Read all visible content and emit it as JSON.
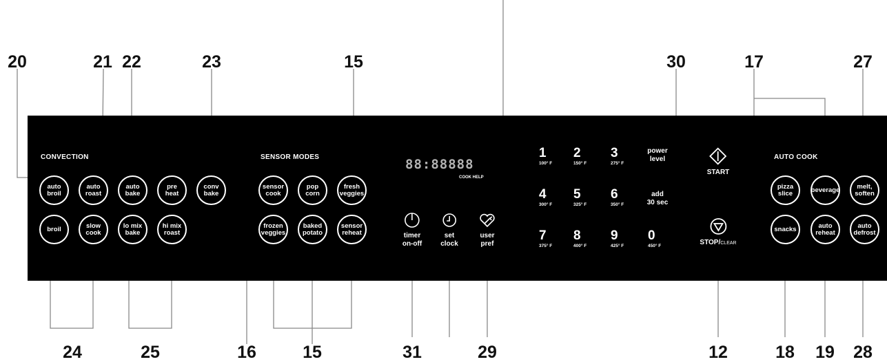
{
  "colors": {
    "panel": "#000000",
    "text_on_panel": "#ffffff",
    "callout": "#111111",
    "leader": "#888888"
  },
  "callouts_top": [
    "20",
    "21",
    "22",
    "23",
    "15",
    "30",
    "17",
    "27"
  ],
  "callouts_bottom": [
    "24",
    "25",
    "16",
    "15",
    "31",
    "29",
    "12",
    "18",
    "19",
    "28"
  ],
  "sections": {
    "convection": "CONVECTION",
    "sensor": "SENSOR MODES",
    "autocook": "AUTO COOK"
  },
  "display": {
    "digits": "88:88888",
    "cook_help": "COOK HELP"
  },
  "convection_buttons": [
    "auto\nbroil",
    "auto\nroast",
    "auto\nbake",
    "pre\nheat",
    "conv\nbake",
    "broil",
    "slow\ncook",
    "lo mix\nbake",
    "hi mix\nroast"
  ],
  "sensor_buttons": [
    "sensor\ncook",
    "pop\ncorn",
    "fresh\nveggies",
    "frozen\nveggies",
    "baked\npotato",
    "sensor\nreheat"
  ],
  "utility_keys": [
    {
      "label": "timer\non-off",
      "icon": "timer-icon"
    },
    {
      "label": "set\nclock",
      "icon": "clock-icon"
    },
    {
      "label": "user\npref",
      "icon": "wrench-heart-icon"
    }
  ],
  "keypad": [
    {
      "num": "1",
      "temp": "100° F"
    },
    {
      "num": "2",
      "temp": "150° F"
    },
    {
      "num": "3",
      "temp": "275° F"
    },
    {
      "num": "4",
      "temp": "300° F"
    },
    {
      "num": "5",
      "temp": "325° F"
    },
    {
      "num": "6",
      "temp": "350° F"
    },
    {
      "num": "7",
      "temp": "375° F"
    },
    {
      "num": "8",
      "temp": "400° F"
    },
    {
      "num": "9",
      "temp": "425° F"
    },
    {
      "num": "0",
      "temp": "450° F"
    }
  ],
  "power_level": "power\nlevel",
  "add_30": "add\n30 sec",
  "start": {
    "label": "START",
    "icon": "start-diamond-icon"
  },
  "stop": {
    "label": "STOP",
    "sub": "CLEAR",
    "icon": "stop-triangle-icon"
  },
  "autocook_buttons": [
    "pizza\nslice",
    "beverage",
    "melt,\nsoften",
    "snacks",
    "auto\nreheat",
    "auto\ndefrost"
  ]
}
